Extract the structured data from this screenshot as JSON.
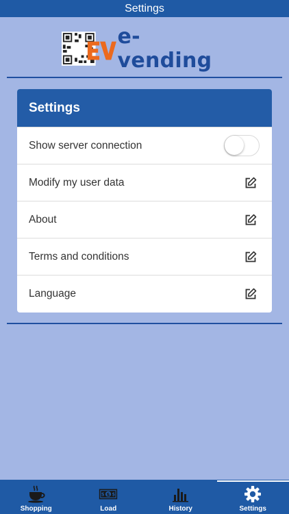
{
  "status_bar": {
    "title": "Settings"
  },
  "brand": {
    "name": "e-vending",
    "mark": "EV"
  },
  "colors": {
    "primary": "#1f5aa5",
    "background": "#a3b6e4",
    "accent_orange": "#ec6a1e"
  },
  "settings": {
    "title": "Settings",
    "items": [
      {
        "label": "Show server connection",
        "control": "toggle",
        "checked": false
      },
      {
        "label": "Modify my user data",
        "control": "edit-icon"
      },
      {
        "label": "About",
        "control": "edit-icon"
      },
      {
        "label": "Terms and conditions",
        "control": "edit-icon"
      },
      {
        "label": "Language",
        "control": "edit-icon"
      }
    ]
  },
  "tabbar": {
    "tabs": [
      {
        "label": "Shopping",
        "icon": "coffee-cup-icon",
        "active": false
      },
      {
        "label": "Load",
        "icon": "banknote-icon",
        "active": false
      },
      {
        "label": "History",
        "icon": "bar-chart-icon",
        "active": false
      },
      {
        "label": "Settings",
        "icon": "gear-icon",
        "active": true
      }
    ]
  }
}
